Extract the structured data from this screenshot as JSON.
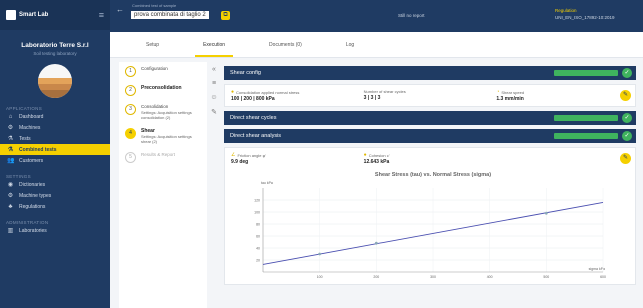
{
  "app": {
    "logo_text": "Smart Lab"
  },
  "sidebar": {
    "lab_name": "Laboratorio Terre S.r.l",
    "lab_sub": "Soil testing laboratory",
    "section_applications": "APPLICATIONS",
    "section_settings": "SETTINGS",
    "section_administration": "ADMINISTRATION",
    "items": [
      {
        "label": "Dashboard",
        "icon": "home-icon"
      },
      {
        "label": "Machines",
        "icon": "machine-icon"
      },
      {
        "label": "Tests",
        "icon": "flask-icon"
      },
      {
        "label": "Combined tests",
        "icon": "flask-icon",
        "active": true
      },
      {
        "label": "Customers",
        "icon": "users-icon"
      }
    ],
    "settings_items": [
      {
        "label": "Dictionaries",
        "icon": "book-icon"
      },
      {
        "label": "Machine types",
        "icon": "machine-icon"
      },
      {
        "label": "Regulations",
        "icon": "regulation-icon"
      }
    ],
    "admin_items": [
      {
        "label": "Laboratories",
        "icon": "building-icon"
      }
    ]
  },
  "topbar": {
    "crumb_small": "Combined test of sample",
    "crumb": "prova combinata di taglio 2",
    "note": "Still no report",
    "regulation_label": "Regulation",
    "regulation_value": "UNI_EN_ISO_17892-10:2019"
  },
  "tabs": [
    "Setup",
    "Execution",
    "Documents (0)",
    "Log"
  ],
  "active_tab": 1,
  "steps": [
    {
      "num": "1",
      "title": "Configuration",
      "sub": "",
      "state": "done"
    },
    {
      "num": "2",
      "title": "Preconsolidation",
      "sub": "",
      "state": "done"
    },
    {
      "num": "3",
      "title": "Consolidation",
      "sub": "Settings: Acquisition settings consolidation (2)",
      "state": "done"
    },
    {
      "num": "4",
      "title": "Shear",
      "sub": "Settings: Acquisition settings shear (2)",
      "state": "active"
    },
    {
      "num": "5",
      "title": "Results & Report",
      "sub": "",
      "state": "disabled"
    }
  ],
  "sections": {
    "shear_config": {
      "title": "Shear config",
      "fields": [
        {
          "label": "Consolidation applied normal stress",
          "value": "100 | 200 | 800 kPa"
        },
        {
          "label": "Number of shear cycles",
          "value": "3 | 3 | 3"
        },
        {
          "label": "Shear speed",
          "value": "1.3 mm/min"
        }
      ]
    },
    "direct_shear_cycles": {
      "title": "Direct shear cycles"
    },
    "direct_shear_analysis": {
      "title": "Direct shear analysis",
      "fields": [
        {
          "label": "Friction angle φ'",
          "value": "9.9 deg"
        },
        {
          "label": "Cohesion c'",
          "value": "12.643 kPa"
        }
      ]
    }
  },
  "colors": {
    "navy": "#1f3b63",
    "yellow": "#f5d000",
    "green": "#3fb35e",
    "line": "#4a4fb0",
    "point": "#8aa9b8"
  },
  "chart_data": {
    "type": "scatter",
    "title": "Shear Stress (tau) vs. Normal Stress (sigma)",
    "ylabel": "tau kPa",
    "xlabel": "sigma kPa",
    "xlim": [
      0,
      600
    ],
    "ylim": [
      0,
      140
    ],
    "xticks": [
      100,
      200,
      300,
      400,
      500,
      600
    ],
    "yticks": [
      20,
      40,
      60,
      80,
      100,
      120
    ],
    "series": [
      {
        "type": "scatter",
        "x": [
          100,
          200,
          500
        ],
        "y": [
          30,
          48,
          98
        ]
      },
      {
        "type": "line",
        "x": [
          0,
          600
        ],
        "y": [
          12.6,
          116
        ]
      }
    ]
  }
}
